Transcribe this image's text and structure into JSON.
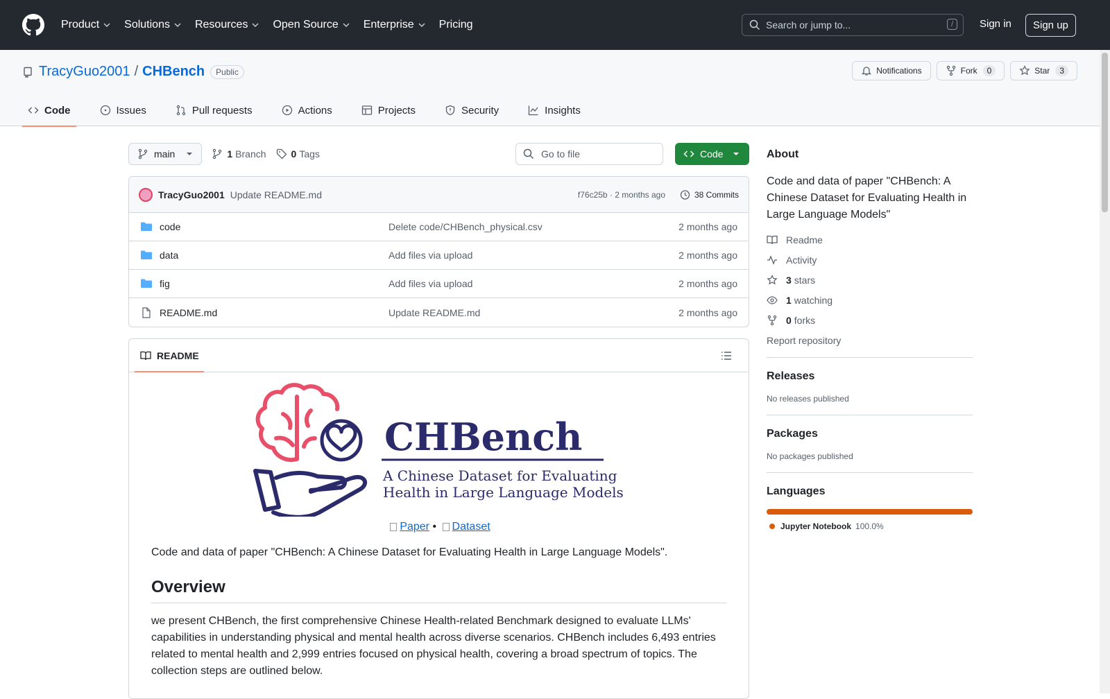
{
  "header": {
    "nav": [
      "Product",
      "Solutions",
      "Resources",
      "Open Source",
      "Enterprise",
      "Pricing"
    ],
    "search_placeholder": "Search or jump to...",
    "search_shortcut": "/",
    "sign_in": "Sign in",
    "sign_up": "Sign up"
  },
  "repo": {
    "owner": "TracyGuo2001",
    "separator": "/",
    "name": "CHBench",
    "visibility": "Public",
    "notifications": "Notifications",
    "fork_label": "Fork",
    "fork_count": "0",
    "star_label": "Star",
    "star_count": "3",
    "tabs": [
      "Code",
      "Issues",
      "Pull requests",
      "Actions",
      "Projects",
      "Security",
      "Insights"
    ]
  },
  "toolbar": {
    "branch": "main",
    "branch_count": "1",
    "branch_label": "Branch",
    "tag_count": "0",
    "tag_label": "Tags",
    "goto_placeholder": "Go to file",
    "code_button": "Code"
  },
  "commit": {
    "author": "TracyGuo2001",
    "message": "Update README.md",
    "meta": "f76c25b · 2 months ago",
    "count": "38 Commits"
  },
  "files": [
    {
      "name": "code",
      "type": "folder",
      "message": "Delete code/CHBench_physical.csv",
      "time": "2 months ago"
    },
    {
      "name": "data",
      "type": "folder",
      "message": "Add files via upload",
      "time": "2 months ago"
    },
    {
      "name": "fig",
      "type": "folder",
      "message": "Add files via upload",
      "time": "2 months ago"
    },
    {
      "name": "README.md",
      "type": "file",
      "message": "Update README.md",
      "time": "2 months ago"
    }
  ],
  "readme": {
    "tab": "README",
    "logo_title": "CHBench",
    "logo_subtitle_1": "A Chinese Dataset for Evaluating",
    "logo_subtitle_2": "Health in Large Language Models",
    "link_paper": "Paper",
    "link_sep": "•",
    "link_dataset": "Dataset",
    "intro": "Code and data of paper \"CHBench: A Chinese Dataset for Evaluating Health in Large Language Models\".",
    "h2": "Overview",
    "overview": "we present CHBench, the first comprehensive Chinese Health-related Benchmark designed to evaluate LLMs' capabilities in understanding physical and mental health across diverse scenarios. CHBench includes 6,493 entries related to mental health and 2,999 entries focused on physical health, covering a broad spectrum of topics. The collection steps are outlined below."
  },
  "about": {
    "title": "About",
    "description": "Code and data of paper \"CHBench: A Chinese Dataset for Evaluating Health in Large Language Models\"",
    "readme": "Readme",
    "activity": "Activity",
    "stars_n": "3",
    "stars": "stars",
    "watching_n": "1",
    "watching": "watching",
    "forks_n": "0",
    "forks": "forks",
    "report": "Report repository"
  },
  "releases": {
    "title": "Releases",
    "empty": "No releases published"
  },
  "packages": {
    "title": "Packages",
    "empty": "No packages published"
  },
  "languages": {
    "title": "Languages",
    "items": [
      {
        "name": "Jupyter Notebook",
        "pct": "100.0%",
        "color": "#da5b0b"
      }
    ]
  },
  "colors": {
    "header_bg": "#24292f",
    "link": "#0969da",
    "green": "#1f883d",
    "tab_underline": "#fd8c73",
    "logo_pink": "#e8506a",
    "logo_navy": "#2b2a6b"
  }
}
